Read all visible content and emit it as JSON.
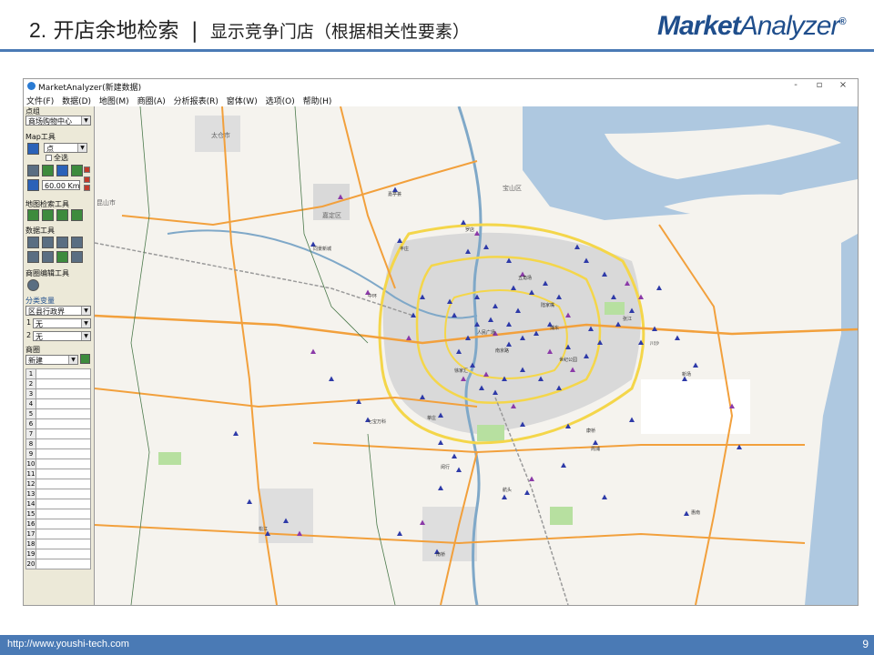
{
  "slide": {
    "number": "2.",
    "title": "开店余地检索",
    "separator": "|",
    "subtitle": "显示竞争门店（根据相关性要素）",
    "logo_bold": "Market",
    "logo_light": "Analyzer",
    "logo_mark": "®",
    "footer_url": "http://www.youshi-tech.com",
    "page_number": "9"
  },
  "window": {
    "title": "MarketAnalyzer(新建数据)",
    "controls": {
      "minimize": "-",
      "maximize": "▫",
      "close": "×"
    }
  },
  "menu": [
    "文件(F)",
    "数据(D)",
    "地图(M)",
    "商圈(A)",
    "分析报表(R)",
    "窗体(W)",
    "选项(O)",
    "帮助(H)"
  ],
  "panel": {
    "point_group_label": "点组",
    "point_group_value": "商场购物中心",
    "map_tools_label": "Map工具",
    "point_select_value": "点",
    "select_all_label": "全选",
    "distance_value": "60.00",
    "distance_unit": "Km",
    "map_search_label": "地图检索工具",
    "data_tools_label": "数据工具",
    "trade_edit_label": "商圈编辑工具",
    "class_var_label": "分类变量",
    "class_var_value": "区县行政界",
    "class_row1_index": "1",
    "class_row1_value": "无",
    "class_row2_index": "2",
    "class_row2_value": "无",
    "trade_label": "商圈",
    "trade_value": "新建",
    "rows": [
      "1",
      "2",
      "3",
      "4",
      "5",
      "6",
      "7",
      "8",
      "9",
      "10",
      "11",
      "12",
      "13",
      "14",
      "15",
      "16",
      "17",
      "18",
      "19",
      "20"
    ]
  },
  "map": {
    "district_labels": [
      "太仓市",
      "嘉定区",
      "宝山区",
      "昆山市"
    ],
    "store_labels": [
      "嘉亭荟",
      "同景新城",
      "丰庄",
      "罗店",
      "中环",
      "七宝万科",
      "人民广场",
      "南京路",
      "徐家汇",
      "五角场",
      "浦东",
      "陆家嘴",
      "世纪公园",
      "张江",
      "川沙",
      "莘庄",
      "松江",
      "闵行",
      "南桥",
      "康桥",
      "周浦",
      "航头",
      "新场",
      "惠南"
    ],
    "colors": {
      "store_blue": "#2e3aa8",
      "store_purple": "#8b3aa8",
      "water": "#aec8e0",
      "road_orange": "#f2a03c",
      "road_yellow": "#f4d64a",
      "urban": "#d4d4d4",
      "green": "#b7e0a0"
    }
  }
}
